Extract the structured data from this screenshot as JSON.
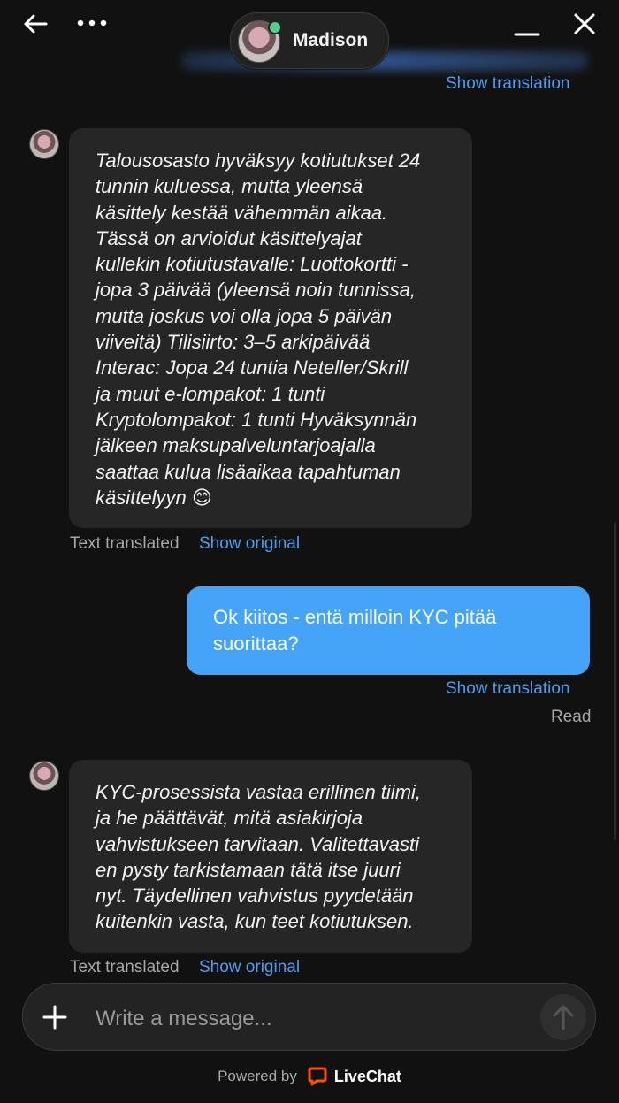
{
  "header": {
    "back_icon": "arrow-left-icon",
    "menu_icon": "more-horizontal-icon",
    "minimize_icon": "minimize-icon",
    "close_icon": "close-icon",
    "agent_name": "Madison",
    "online_color": "#4fd28c"
  },
  "messages": [
    {
      "from": "agent",
      "top_action": "Show translation"
    },
    {
      "from": "agent",
      "text": "Talousosasto hyväksyy kotiutukset 24\ntunnin kuluessa, mutta yleensä\nkäsittely kestää vähemmän aikaa.\nTässä on arvioidut käsittelyajat\nkullekin kotiutustavalle: Luottokortti -\njopa 3 päivää (yleensä noin tunnissa,\nmutta joskus voi olla jopa 5 päivän\nviiveitä) Tilisiirto: 3–5 arkipäivää\nInterac: Jopa 24 tuntia Neteller/Skrill\nja muut e-lompakot: 1 tunti\nKryptolompakot: 1 tunti Hyväksynnän\njälkeen maksupalveluntarjoajalla\nsaattaa kulua lisäaikaa tapahtuman\nkäsittelyyn 😊",
      "status": "Text translated",
      "action": "Show original"
    },
    {
      "from": "user",
      "text": "Ok kiitos - entä milloin KYC pitää\nsuorittaa?",
      "action": "Show translation",
      "receipt": "Read"
    },
    {
      "from": "agent",
      "text": "KYC-prosessista vastaa erillinen tiimi,\nja he päättävät, mitä asiakirjoja\nvahvistukseen tarvitaan. Valitettavasti\nen pysty tarkistamaan tätä itse juuri\nnyt. Täydellinen vahvistus pyydetään\nkuitenkin vasta, kun teet kotiutuksen.",
      "status": "Text translated",
      "action": "Show original"
    }
  ],
  "composer": {
    "add_icon": "plus-icon",
    "placeholder": "Write a message...",
    "send_icon": "arrow-up-icon"
  },
  "footer": {
    "powered_by": "Powered by",
    "brand": "LiveChat",
    "brand_icon": "livechat-logo-icon",
    "brand_color": "#ff5100"
  },
  "colors": {
    "background": "#111111",
    "agent_bubble": "#262626",
    "user_bubble": "#45a4f7",
    "link": "#4e9cf0"
  }
}
